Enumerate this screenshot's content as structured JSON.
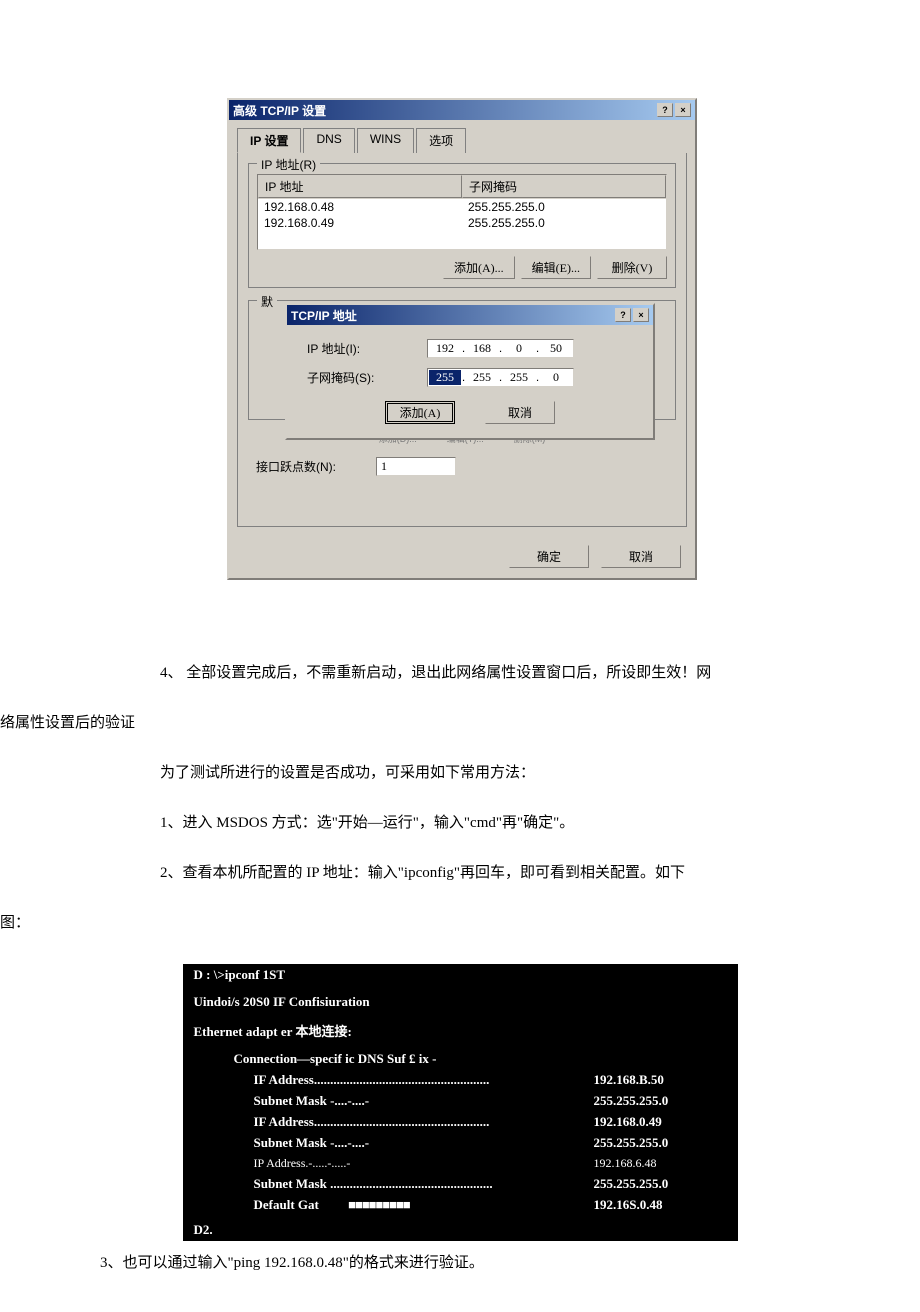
{
  "mainWindow": {
    "title": "高级 TCP/IP 设置",
    "helpBtn": "?",
    "closeBtn": "×",
    "tabs": [
      "IP 设置",
      "DNS",
      "WINS",
      "选项"
    ],
    "ipGroup": {
      "label": "IP 地址(R)",
      "headers": [
        "IP 地址",
        "子网掩码"
      ],
      "rows": [
        {
          "ip": "192.168.0.48",
          "mask": "255.255.255.0"
        },
        {
          "ip": "192.168.0.49",
          "mask": "255.255.255.0"
        }
      ],
      "addBtn": "添加(A)...",
      "editBtn": "编辑(E)...",
      "deleteBtn": "删除(V)"
    },
    "gatewayGroup": {
      "label": "默"
    },
    "ghostBtns": [
      "添加(D)...",
      "编辑(T)...",
      "删除(M)"
    ],
    "metric": {
      "label": "接口跃点数(N):",
      "value": "1"
    },
    "okBtn": "确定",
    "cancelBtn": "取消"
  },
  "innerDialog": {
    "title": "TCP/IP 地址",
    "helpBtn": "?",
    "closeBtn": "×",
    "ipLabel": "IP 地址(I):",
    "ipOctets": [
      "192",
      "168",
      "0",
      "50"
    ],
    "maskLabel": "子网掩码(S):",
    "maskOctets": [
      "255",
      "255",
      "255",
      "0"
    ],
    "addBtn": "添加(A)",
    "cancelBtn": "取消"
  },
  "doc": {
    "p1": "4、 全部设置完成后，不需重新启动，退出此网络属性设置窗口后，所设即生效！网",
    "p1b": "络属性设置后的验证",
    "p2": "为了测试所进行的设置是否成功，可采用如下常用方法：",
    "p3": "1、进入 MSDOS 方式：选\"开始—运行\"，输入\"cmd\"再\"确定\"。",
    "p4": "2、查看本机所配置的 IP 地址：输入\"ipconfig\"再回车，即可看到相关配置。如下",
    "p4b": "图：",
    "p5": "3、也可以通过输入\"ping 192.168.0.48\"的格式来进行验证。"
  },
  "terminal": {
    "line1": "D : \\>ipconf 1ST",
    "line2": "Uindoi/s 20S0 IF Confisiuration",
    "line3": "Ethernet adapt er 本地连接:",
    "line4": "Connection—specif ic DNS Suf £ ix -",
    "line5a": "IF Address......................................................",
    "line5b": "192.168.B.50",
    "line6a": "Subnet Mask -....-....-",
    "line6b": "255.255.255.0",
    "line7a": "IF Address......................................................",
    "line7b": "192.168.0.49",
    "line8a": "Subnet Mask -....-....-",
    "line8b": "255.255.255.0",
    "line9a": "IP Address.-.....-.....-",
    "line9b": "192.168.6.48",
    "line10a": "Subnet Mask ..................................................",
    "line10b": "255.255.255.0",
    "line11a": "Default Gat",
    "line11b": "192.16S.0.48",
    "line12": "D2."
  }
}
